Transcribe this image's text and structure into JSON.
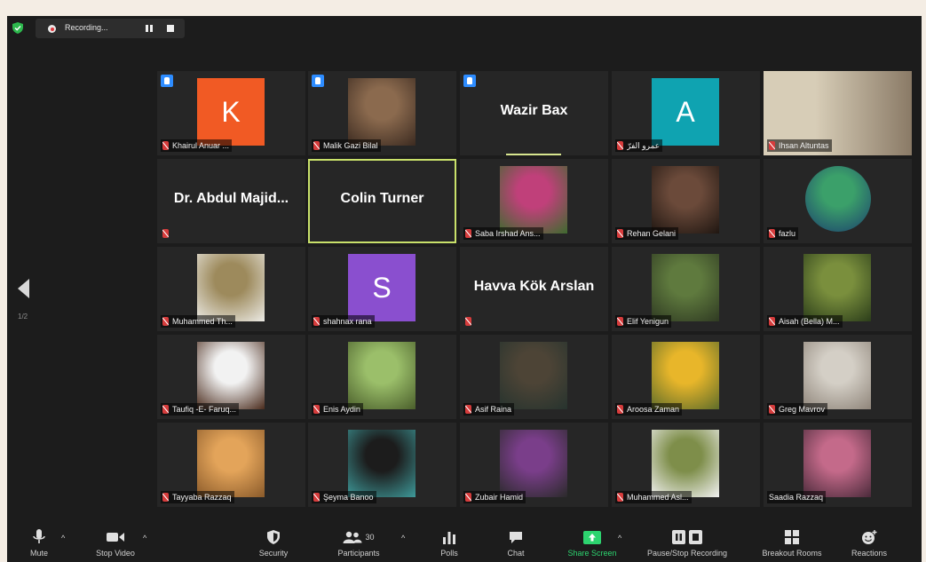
{
  "recording": {
    "label": "Recording..."
  },
  "pagination": {
    "page_indicator": "1/2"
  },
  "tiles": [
    {
      "type": "avatar",
      "name": "Khairul Anuar ...",
      "letter": "K",
      "color": "#f15a24",
      "raised": true
    },
    {
      "type": "photo",
      "name": "Malik Gazi Bilal",
      "photo": [
        "#8b6a4e",
        "#3b2a20"
      ],
      "raised": true
    },
    {
      "type": "text",
      "name": "Wazir Bax",
      "raised": true,
      "speaking": true
    },
    {
      "type": "avatar",
      "name": "عمرو الفرّ",
      "letter": "A",
      "color": "#0fa3b1"
    },
    {
      "type": "full",
      "name": "Ihsan Altuntas",
      "photo": [
        "#d7cdb7",
        "#8a7a66"
      ]
    },
    {
      "type": "text",
      "name": "Dr. Abdul Majid...",
      "mic_only": true
    },
    {
      "type": "text",
      "name": "Colin Turner",
      "active": true
    },
    {
      "type": "photo",
      "name": "Saba Irshad Ans...",
      "photo": [
        "#c0407a",
        "#3e6b2e"
      ]
    },
    {
      "type": "photo",
      "name": "Rehan Gelani",
      "photo": [
        "#6b4a3a",
        "#1f1611"
      ]
    },
    {
      "type": "photo",
      "name": "fazlu",
      "photo": [
        "#3ba06a",
        "#1b3f6e"
      ],
      "round": true
    },
    {
      "type": "photo",
      "name": "Muhammed Th...",
      "photo": [
        "#9d8a5c",
        "#ecebe6"
      ]
    },
    {
      "type": "avatar",
      "name": "shahnax rana",
      "letter": "S",
      "color": "#8a4fcf"
    },
    {
      "type": "text",
      "name": "Havva Kök Arslan",
      "mic_only": true
    },
    {
      "type": "photo",
      "name": "Elif Yenigun",
      "photo": [
        "#5f7a3e",
        "#2f3a22"
      ]
    },
    {
      "type": "photo",
      "name": "Aisah (Bella) M...",
      "photo": [
        "#7a8f3d",
        "#2b3d1a"
      ]
    },
    {
      "type": "photo",
      "name": "Taufiq -E- Faruq...",
      "photo": [
        "#f2f2f2",
        "#4a2b1c"
      ]
    },
    {
      "type": "photo",
      "name": "Enis Aydin",
      "photo": [
        "#9bbf6a",
        "#4a5e2b"
      ]
    },
    {
      "type": "photo",
      "name": "Asif Raina",
      "photo": [
        "#4d4436",
        "#26332e"
      ]
    },
    {
      "type": "photo",
      "name": "Aroosa Zaman",
      "photo": [
        "#e8b62a",
        "#5e6c2a"
      ]
    },
    {
      "type": "photo",
      "name": "Greg Mavrov",
      "photo": [
        "#d4cfc6",
        "#8f857a"
      ]
    },
    {
      "type": "photo",
      "name": "Tayyaba Razzaq",
      "photo": [
        "#e3a45a",
        "#8a5a2a"
      ]
    },
    {
      "type": "photo",
      "name": "Şeyma Banoo",
      "photo": [
        "#1c1c1c",
        "#3e9a9a"
      ]
    },
    {
      "type": "photo",
      "name": "Zubair Hamid",
      "photo": [
        "#7a3e8a",
        "#2a2a2a"
      ]
    },
    {
      "type": "photo",
      "name": "Muhammed Asl...",
      "photo": [
        "#7e8e4a",
        "#f2f2f2"
      ]
    },
    {
      "type": "photo",
      "name": "Saadia Razzaq",
      "photo": [
        "#c46a8a",
        "#4a2a3a"
      ],
      "no_mic": true
    }
  ],
  "toolbar": {
    "mute": "Mute",
    "stop_video": "Stop Video",
    "security": "Security",
    "participants": "Participants",
    "participants_count": "30",
    "polls": "Polls",
    "chat": "Chat",
    "share_screen": "Share Screen",
    "pause_stop_recording": "Pause/Stop Recording",
    "breakout_rooms": "Breakout Rooms",
    "reactions": "Reactions"
  },
  "colors": {
    "share_green": "#2dd36f",
    "active_border": "#c9e16a",
    "raise_hand_blue": "#2d8cff"
  }
}
